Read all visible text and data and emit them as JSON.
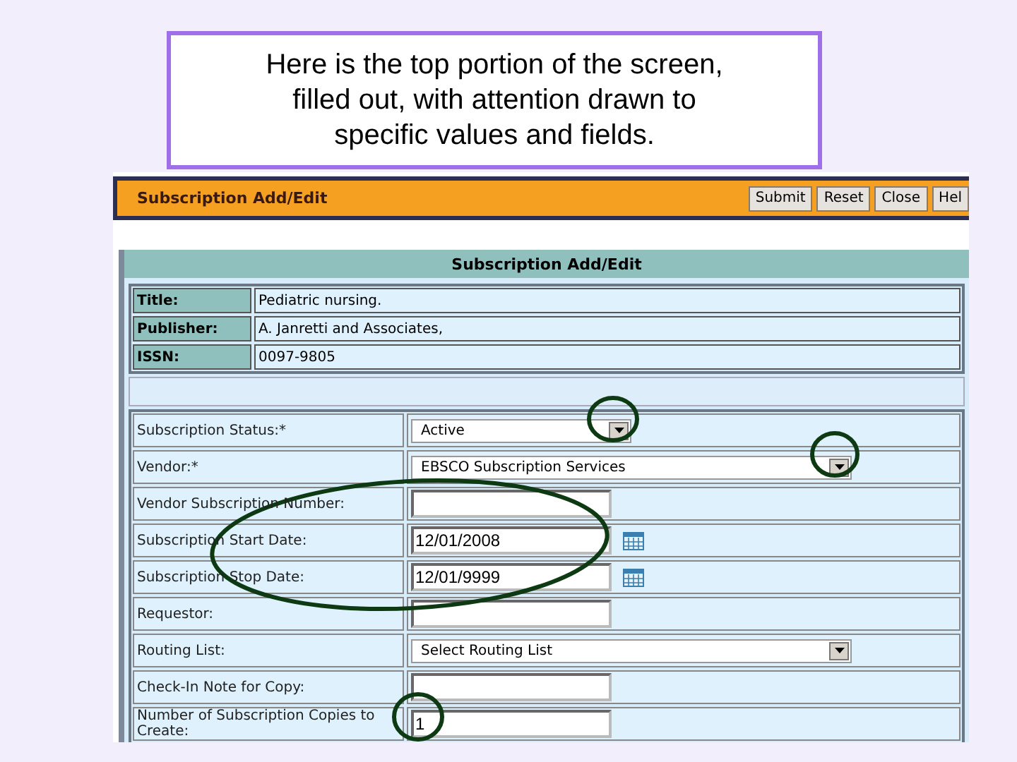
{
  "caption": "Here is the top portion of the screen, filled out, with attention drawn to specific values and fields.",
  "header": {
    "title": "Subscription Add/Edit",
    "buttons": [
      "Submit",
      "Reset",
      "Close",
      "Hel"
    ]
  },
  "record": {
    "title": "Subscription Add/Edit",
    "rows": [
      {
        "label": "Title:",
        "value": "Pediatric nursing."
      },
      {
        "label": "Publisher:",
        "value": "A. Janretti and Associates,"
      },
      {
        "label": "ISSN:",
        "value": "0097-9805"
      }
    ]
  },
  "form": {
    "fields": [
      {
        "label": "Subscription Status:*",
        "kind": "select",
        "value": "Active"
      },
      {
        "label": "Vendor:*",
        "kind": "wide-select",
        "value": "EBSCO Subscription Services"
      },
      {
        "label": "Vendor Subscription Number:",
        "kind": "text"
      },
      {
        "label": "Subscription Start Date:",
        "kind": "date",
        "value": "12/01/2008"
      },
      {
        "label": "Subscription Stop Date:",
        "kind": "date",
        "value": "12/01/9999"
      },
      {
        "label": "Requestor:",
        "kind": "text"
      },
      {
        "label": "Routing List:",
        "kind": "wide-select",
        "value": "Select Routing List"
      },
      {
        "label": "Check-In Note for Copy:",
        "kind": "text"
      },
      {
        "label": "Number of Subscription Copies to Create:",
        "kind": "text",
        "value": "1"
      }
    ]
  }
}
